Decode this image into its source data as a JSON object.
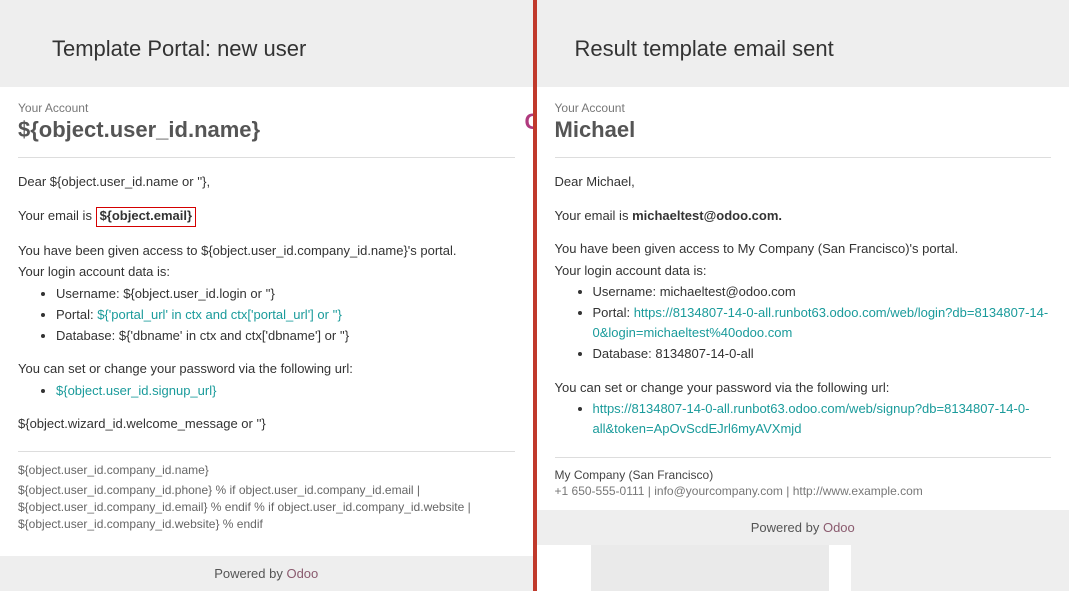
{
  "left": {
    "header": "Template Portal: new user",
    "account_label": "Your Account",
    "title": "${object.user_id.name}",
    "dear": "Dear ${object.user_id.name or ''},",
    "email_prefix": "Your email is ",
    "email_value": "${object.email}",
    "access": "You have been given access to ${object.user_id.company_id.name}'s portal.",
    "login_intro": "Your login account data is:",
    "username_label": "Username: ",
    "username_value": "${object.user_id.login or ''}",
    "portal_label": "Portal: ",
    "portal_value": "${'portal_url' in ctx and ctx['portal_url'] or ''}",
    "database_label": "Database: ",
    "database_value": "${'dbname' in ctx and ctx['dbname'] or ''}",
    "pw_line": "You can set or change your password via the following url:",
    "signup_url": "${object.user_id.signup_url}",
    "welcome": "${object.wizard_id.welcome_message or ''}",
    "footer1": "${object.user_id.company_id.name}",
    "footer2": "${object.user_id.company_id.phone} % if object.user_id.company_id.email | ${object.user_id.company_id.email} % endif % if object.user_id.company_id.website | ${object.user_id.company_id.website} % endif",
    "powered": "Powered by ",
    "odoo": "Odoo"
  },
  "right": {
    "header": "Result template email sent",
    "account_label": "Your Account",
    "title": "Michael",
    "dear": "Dear Michael,",
    "email_prefix": "Your email is ",
    "email_value": "michaeltest@odoo.com.",
    "access": "You have been given access to My Company (San Francisco)'s portal.",
    "login_intro": "Your login account data is:",
    "username_label": "Username: ",
    "username_value": "michaeltest@odoo.com",
    "portal_label": "Portal: ",
    "portal_value": "https://8134807-14-0-all.runbot63.odoo.com/web/login?db=8134807-14-0&login=michaeltest%40odoo.com",
    "database_label": "Database: ",
    "database_value": "8134807-14-0-all",
    "pw_line": "You can set or change your password via the following url:",
    "signup_url": "https://8134807-14-0-all.runbot63.odoo.com/web/signup?db=8134807-14-0-all&token=ApOvScdEJrl6myAVXmjd",
    "company": "My Company (San Francisco)",
    "company_line": "+1 650-555-0111 | info@yourcompany.com | http://www.example.com",
    "powered": "Powered by ",
    "odoo": "Odoo"
  }
}
